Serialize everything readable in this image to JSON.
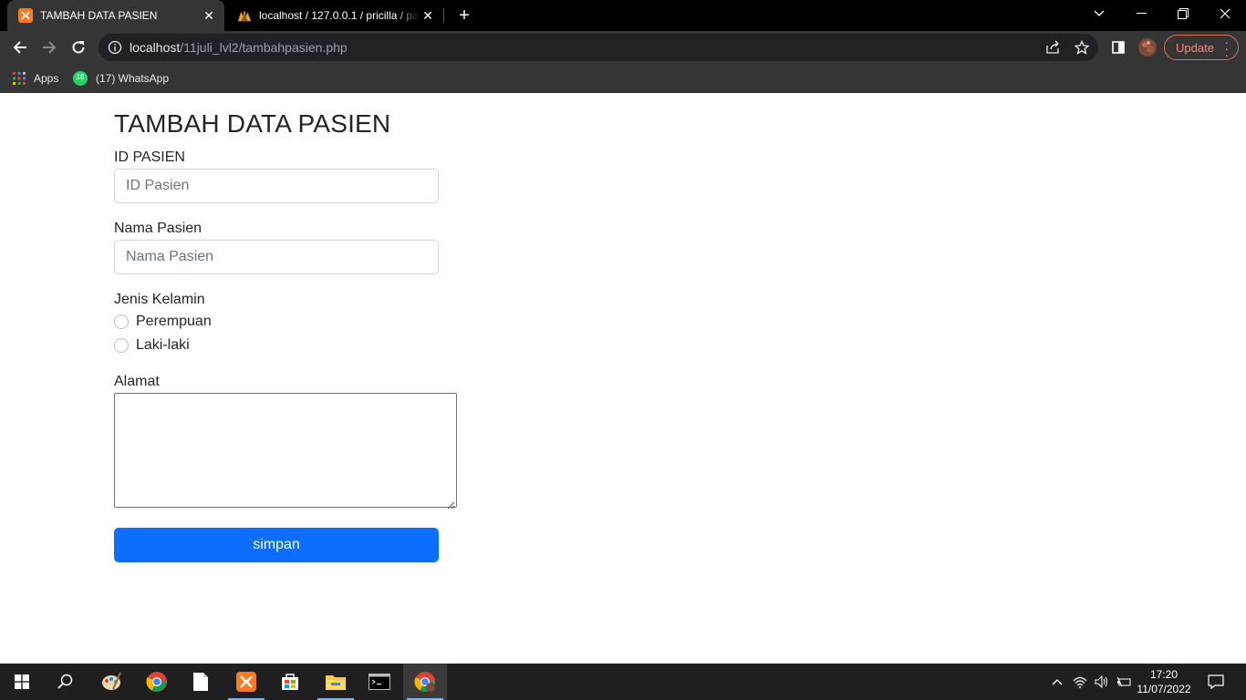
{
  "browser": {
    "tabs": [
      {
        "title": "TAMBAH DATA PASIEN",
        "icon": "xampp-icon",
        "active": true
      },
      {
        "title": "localhost / 127.0.0.1 / pricilla / pa",
        "icon": "phpmyadmin-icon",
        "active": false
      }
    ],
    "address": {
      "host": "localhost",
      "path": "/11juli_lvl2/tambahpasien.php"
    },
    "update_label": "Update",
    "bookmarks": [
      {
        "label": "Apps",
        "icon": "apps-grid-icon"
      },
      {
        "label": "(17) WhatsApp",
        "icon": "whatsapp-icon",
        "badge": "18"
      }
    ]
  },
  "form": {
    "heading": "TAMBAH DATA PASIEN",
    "id_label": "ID PASIEN",
    "id_placeholder": "ID Pasien",
    "nama_label": "Nama Pasien",
    "nama_placeholder": "Nama Pasien",
    "gender_label": "Jenis Kelamin",
    "gender_options": [
      "Perempuan",
      "Laki-laki"
    ],
    "alamat_label": "Alamat",
    "submit_label": "simpan"
  },
  "taskbar": {
    "time": "17:20",
    "date": "11/07/2022"
  },
  "colors": {
    "primary_button": "#0d6efd",
    "tab_bar": "#000000",
    "toolbar": "#353535"
  }
}
